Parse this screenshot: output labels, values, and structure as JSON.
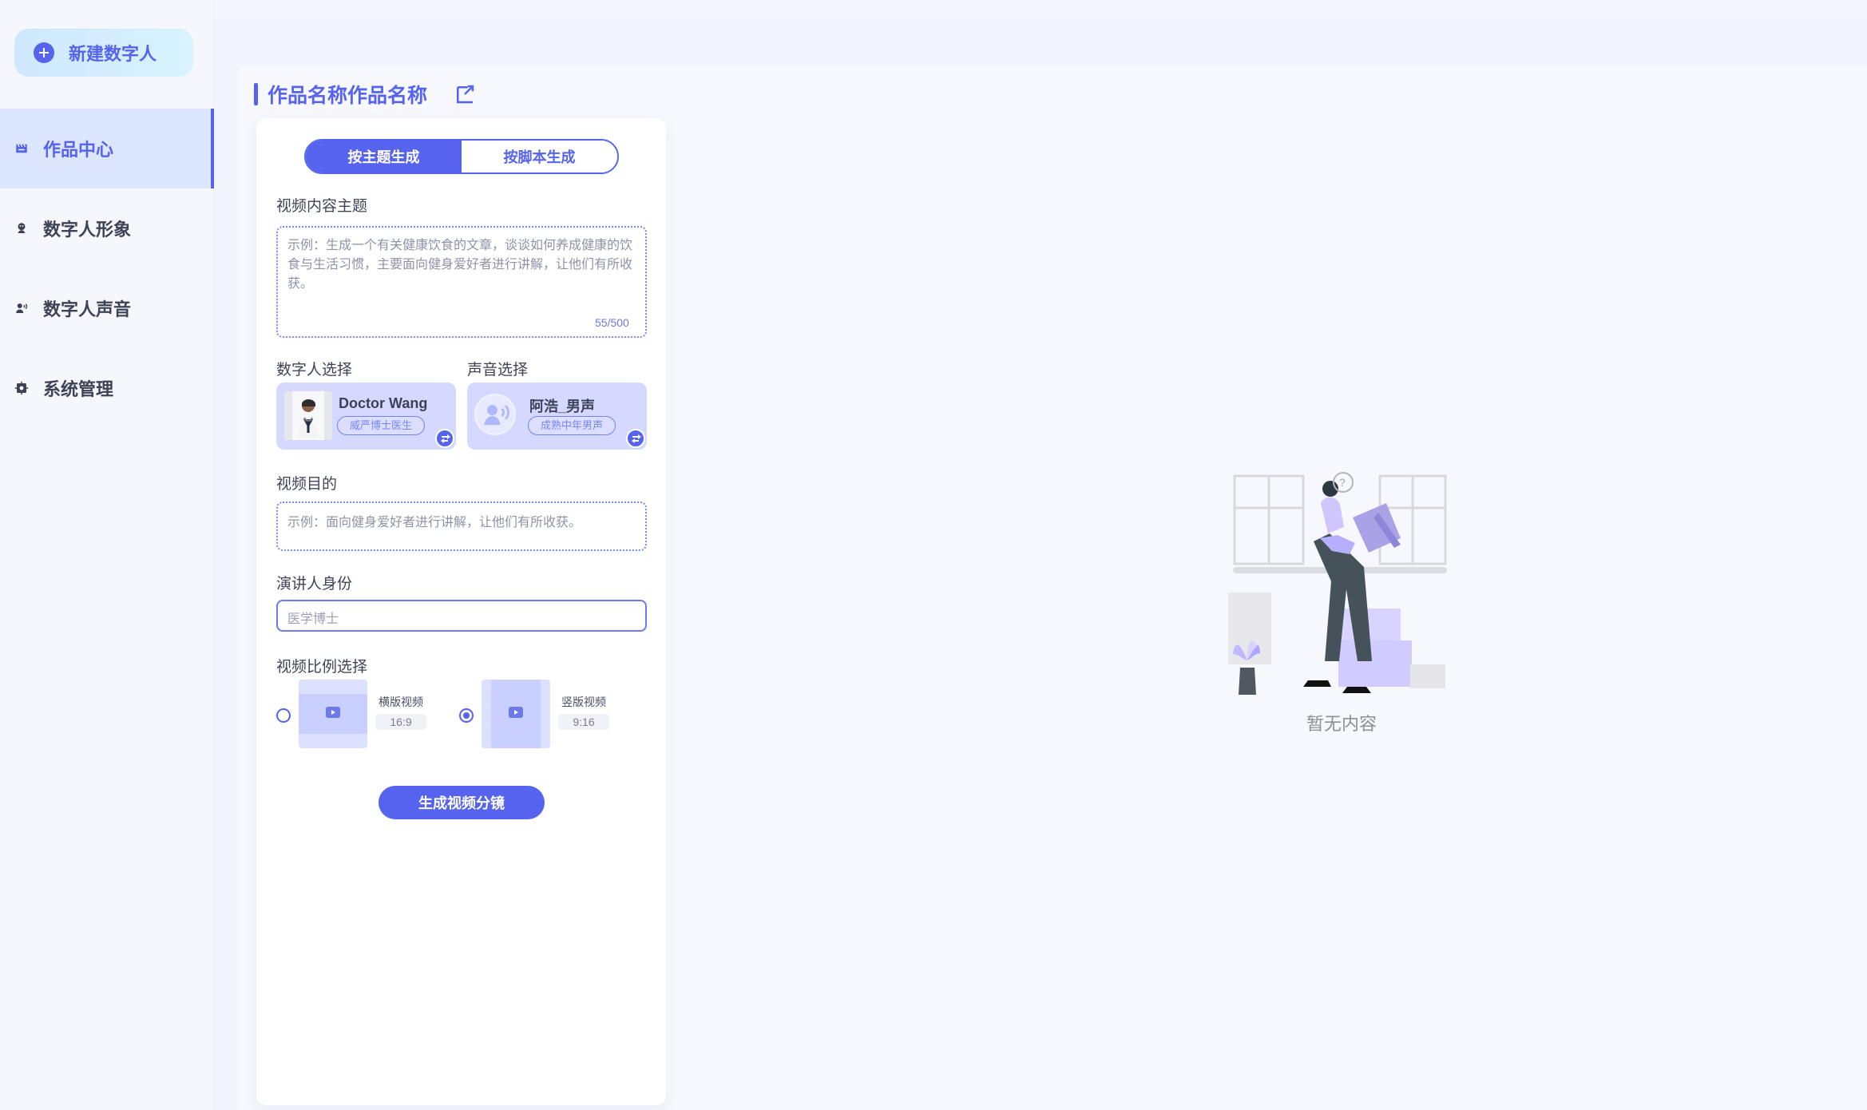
{
  "sidebar": {
    "new_button": "新建数字人",
    "items": [
      {
        "label": "作品中心",
        "icon": "film-icon",
        "active": true
      },
      {
        "label": "数字人形象",
        "icon": "avatar-icon",
        "active": false
      },
      {
        "label": "数字人声音",
        "icon": "voice-icon",
        "active": false
      },
      {
        "label": "系统管理",
        "icon": "gear-icon",
        "active": false
      }
    ]
  },
  "header": {
    "title": "作品名称作品名称"
  },
  "tabs": [
    {
      "label": "按主题生成",
      "active": true
    },
    {
      "label": "按脚本生成",
      "active": false
    }
  ],
  "form": {
    "topic_label": "视频内容主题",
    "topic_value": "示例：生成一个有关健康饮食的文章，谈谈如何养成健康的饮食与生活习惯，主要面向健身爱好者进行讲解，让他们有所收获。",
    "topic_counter": "55/500",
    "digital_label": "数字人选择",
    "voice_label": "声音选择",
    "digital_person": {
      "name": "Doctor  Wang",
      "tag": "威严博士医生"
    },
    "voice": {
      "name": "阿浩_男声",
      "tag": "成熟中年男声"
    },
    "goal_label": "视频目的",
    "goal_placeholder": "示例：面向健身爱好者进行讲解，让他们有所收获。",
    "speaker_label": "演讲人身份",
    "speaker_placeholder": "医学博士",
    "ratio_label": "视频比例选择",
    "ratio_options": [
      {
        "title": "横版视频",
        "ratio": "16:9",
        "checked": false
      },
      {
        "title": "竖版视频",
        "ratio": "9:16",
        "checked": true
      }
    ],
    "generate_button": "生成视频分镜"
  },
  "empty_state": {
    "text": "暂无内容"
  },
  "colors": {
    "accent": "#5563EE",
    "card": "#D5D9FF"
  }
}
